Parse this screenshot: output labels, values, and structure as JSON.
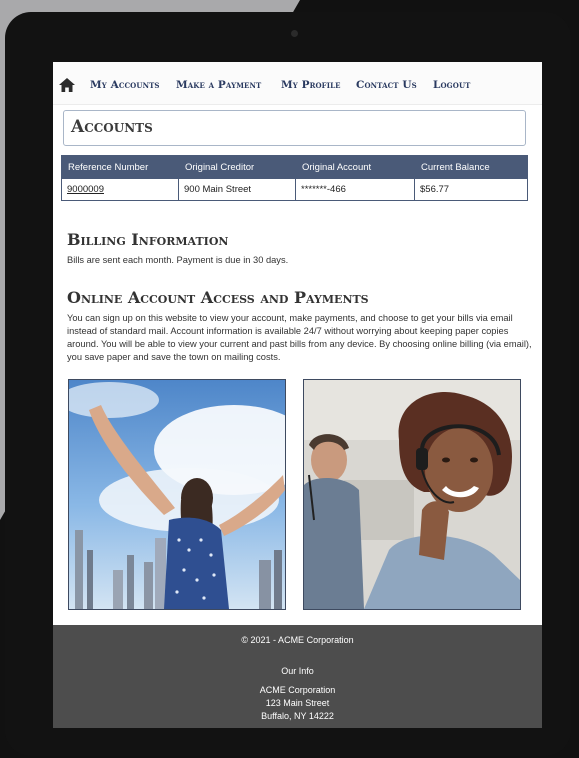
{
  "nav": {
    "items": [
      "My Accounts",
      "Make a Payment",
      "My Profile",
      "Contact Us",
      "Logout"
    ]
  },
  "accounts": {
    "title": "Accounts",
    "columns": [
      "Reference Number",
      "Original Creditor",
      "Original Account",
      "Current Balance"
    ],
    "rows": [
      {
        "reference": "9000009",
        "creditor": "900 Main Street",
        "account": "*******-466",
        "balance": "$56.77"
      }
    ]
  },
  "billing": {
    "heading": "Billing Information",
    "text": "Bills are sent each month. Payment is due in 30 days."
  },
  "online": {
    "heading": "Online Account Access and Payments",
    "text": "You can sign up on this website to view your account, make payments, and choose to get your bills via email instead of standard mail. Account information is available 24/7 without worrying about keeping paper copies around. You will be able to view your current and past bills from any device. By choosing online billing (via email), you save paper and save the town on mailing costs."
  },
  "footer": {
    "copyright": "© 2021 - ACME Corporation",
    "heading": "Our Info",
    "company": "ACME Corporation",
    "street": "123 Main Street",
    "city": "Buffalo, NY 14222"
  },
  "colors": {
    "nav_text": "#2a3a60",
    "table_header": "#4a5a78",
    "footer_bg": "#4d4d4d"
  }
}
